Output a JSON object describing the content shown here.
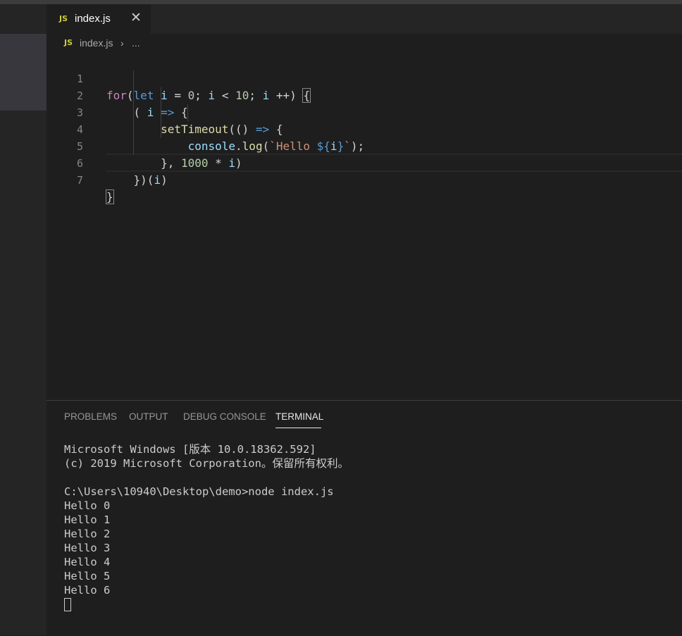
{
  "tab": {
    "icon": "JS",
    "label": "index.js",
    "close": "✕"
  },
  "breadcrumb": {
    "icon": "JS",
    "file": "index.js",
    "sep": "›",
    "more": "..."
  },
  "editor": {
    "line_numbers": [
      "1",
      "2",
      "3",
      "4",
      "5",
      "6",
      "7"
    ]
  },
  "panel": {
    "tabs": [
      "PROBLEMS",
      "OUTPUT",
      "DEBUG CONSOLE",
      "TERMINAL"
    ],
    "active_tab": "TERMINAL"
  },
  "terminal": {
    "lines": [
      "Microsoft Windows [版本 10.0.18362.592]",
      "(c) 2019 Microsoft Corporation。保留所有权利。",
      "",
      "C:\\Users\\10940\\Desktop\\demo>node index.js",
      "Hello 0",
      "Hello 1",
      "Hello 2",
      "Hello 3",
      "Hello 4",
      "Hello 5",
      "Hello 6"
    ]
  }
}
